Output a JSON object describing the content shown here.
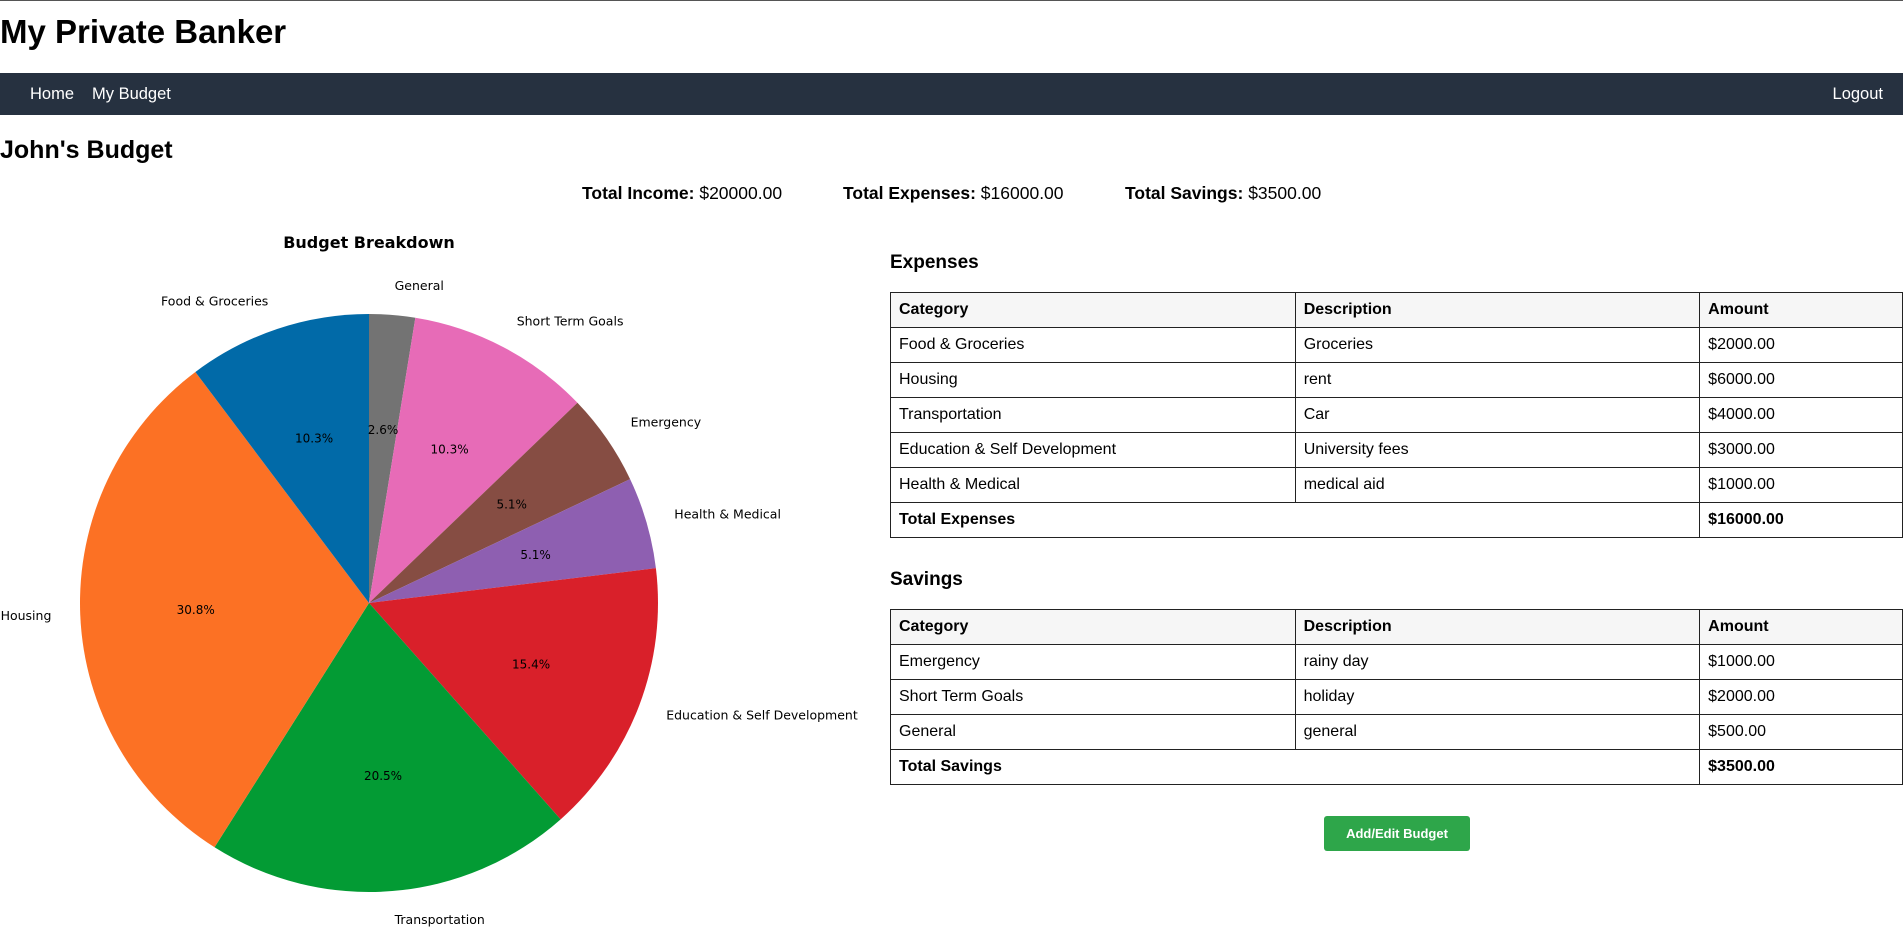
{
  "app": {
    "title": "My Private Banker"
  },
  "nav": {
    "home": "Home",
    "my_budget": "My Budget",
    "logout": "Logout"
  },
  "page": {
    "title": "John's Budget"
  },
  "summary": {
    "income_label": "Total Income:",
    "income_value": "$20000.00",
    "expenses_label": "Total Expenses:",
    "expenses_value": "$16000.00",
    "savings_label": "Total Savings:",
    "savings_value": "$3500.00"
  },
  "chart_data": {
    "type": "pie",
    "title": "Budget Breakdown",
    "slices": [
      {
        "label": "General",
        "value": 500,
        "pct_label": "2.6%",
        "color": "#737373"
      },
      {
        "label": "Short Term Goals",
        "value": 2000,
        "pct_label": "10.3%",
        "color": "#e76bb7"
      },
      {
        "label": "Emergency",
        "value": 1000,
        "pct_label": "5.1%",
        "color": "#864d43"
      },
      {
        "label": "Health & Medical",
        "value": 1000,
        "pct_label": "5.1%",
        "color": "#8e5fb1"
      },
      {
        "label": "Education & Self Development",
        "value": 3000,
        "pct_label": "15.4%",
        "color": "#d9202a"
      },
      {
        "label": "Transportation",
        "value": 4000,
        "pct_label": "20.5%",
        "color": "#039b34"
      },
      {
        "label": "Housing",
        "value": 6000,
        "pct_label": "30.8%",
        "color": "#fc7124"
      },
      {
        "label": "Food & Groceries",
        "value": 2000,
        "pct_label": "10.3%",
        "color": "#016aa8"
      }
    ],
    "start": "12 o'clock",
    "direction": "clockwise"
  },
  "expenses": {
    "title": "Expenses",
    "headers": [
      "Category",
      "Description",
      "Amount"
    ],
    "rows": [
      [
        "Food & Groceries",
        "Groceries",
        "$2000.00"
      ],
      [
        "Housing",
        "rent",
        "$6000.00"
      ],
      [
        "Transportation",
        "Car",
        "$4000.00"
      ],
      [
        "Education & Self Development",
        "University fees",
        "$3000.00"
      ],
      [
        "Health & Medical",
        "medical aid",
        "$1000.00"
      ]
    ],
    "total_label": "Total Expenses",
    "total_value": "$16000.00"
  },
  "savings": {
    "title": "Savings",
    "headers": [
      "Category",
      "Description",
      "Amount"
    ],
    "rows": [
      [
        "Emergency",
        "rainy day",
        "$1000.00"
      ],
      [
        "Short Term Goals",
        "holiday",
        "$2000.00"
      ],
      [
        "General",
        "general",
        "$500.00"
      ]
    ],
    "total_label": "Total Savings",
    "total_value": "$3500.00"
  },
  "actions": {
    "add_edit": "Add/Edit Budget"
  }
}
